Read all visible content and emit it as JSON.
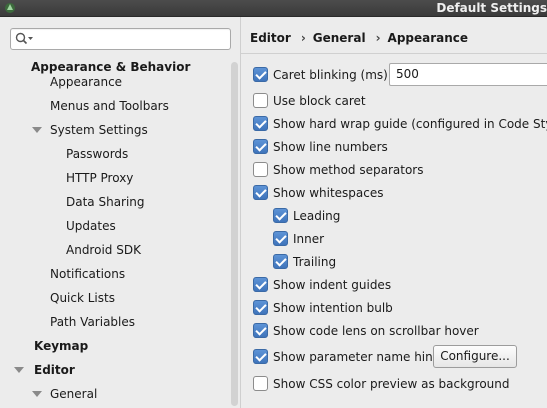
{
  "window": {
    "title": "Default Settings"
  },
  "search": {
    "value": ""
  },
  "tree": {
    "appearance_behavior": "Appearance & Behavior",
    "appearance": "Appearance",
    "menus_toolbars": "Menus and Toolbars",
    "system_settings": "System Settings",
    "passwords": "Passwords",
    "http_proxy": "HTTP Proxy",
    "data_sharing": "Data Sharing",
    "updates": "Updates",
    "android_sdk": "Android SDK",
    "notifications": "Notifications",
    "quick_lists": "Quick Lists",
    "path_variables": "Path Variables",
    "keymap": "Keymap",
    "editor": "Editor",
    "general": "General"
  },
  "breadcrumb": {
    "part1": "Editor",
    "part2": "General",
    "part3": "Appearance"
  },
  "options": {
    "caret_blinking": {
      "label": "Caret blinking (ms):",
      "checked": true,
      "value": "500"
    },
    "block_caret": {
      "label": "Use block caret",
      "checked": false
    },
    "hard_wrap": {
      "label": "Show hard wrap guide (configured in Code Style options)",
      "checked": true
    },
    "line_numbers": {
      "label": "Show line numbers",
      "checked": true
    },
    "method_separators": {
      "label": "Show method separators",
      "checked": false
    },
    "whitespaces": {
      "label": "Show whitespaces",
      "checked": true
    },
    "leading": {
      "label": "Leading",
      "checked": true
    },
    "inner": {
      "label": "Inner",
      "checked": true
    },
    "trailing": {
      "label": "Trailing",
      "checked": true
    },
    "indent_guides": {
      "label": "Show indent guides",
      "checked": true
    },
    "intention_bulb": {
      "label": "Show intention bulb",
      "checked": true
    },
    "code_lens": {
      "label": "Show code lens on scrollbar hover",
      "checked": true
    },
    "param_hints": {
      "label": "Show parameter name hints",
      "checked": true
    },
    "css_color": {
      "label": "Show CSS color preview as background",
      "checked": false
    }
  },
  "configure_button": "Configure...",
  "colors": {
    "checkbox_checked": "#4a80c6",
    "title_bar": "#3f3f3f"
  }
}
